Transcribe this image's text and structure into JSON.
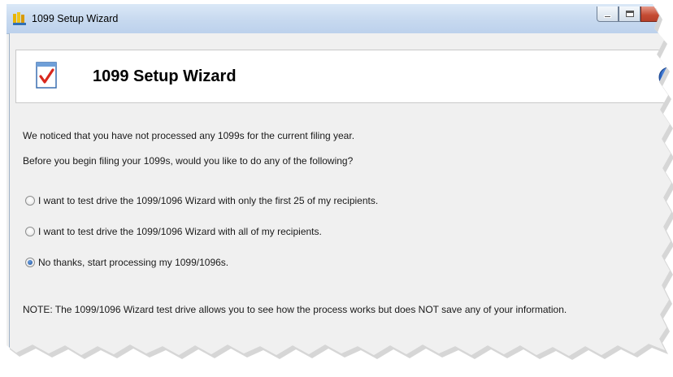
{
  "window": {
    "title": "1099 Setup Wizard",
    "icon": "1099-app-icon"
  },
  "header": {
    "title": "1099 Setup Wizard",
    "icon": "checklist-document-icon",
    "help_icon": "help-icon"
  },
  "body": {
    "intro": "We noticed that you have not processed any 1099s for the current filing year.",
    "question": "Before you begin filing your 1099s, would you like to do any of the following?",
    "options": [
      {
        "label": "I want to test drive the 1099/1096 Wizard with only the first 25 of my recipients.",
        "checked": false
      },
      {
        "label": "I want to test drive the 1099/1096 Wizard with all of my recipients.",
        "checked": false
      },
      {
        "label": "No thanks, start processing my 1099/1096s.",
        "checked": true
      }
    ],
    "note": "NOTE: The 1099/1096 Wizard test drive allows you to see how the process works but does NOT save any of your information."
  },
  "colors": {
    "titlebar": "#c7d9ef",
    "client": "#f0f0f0",
    "close_button": "#c44a32",
    "radio_dot": "#1c4f9c"
  }
}
